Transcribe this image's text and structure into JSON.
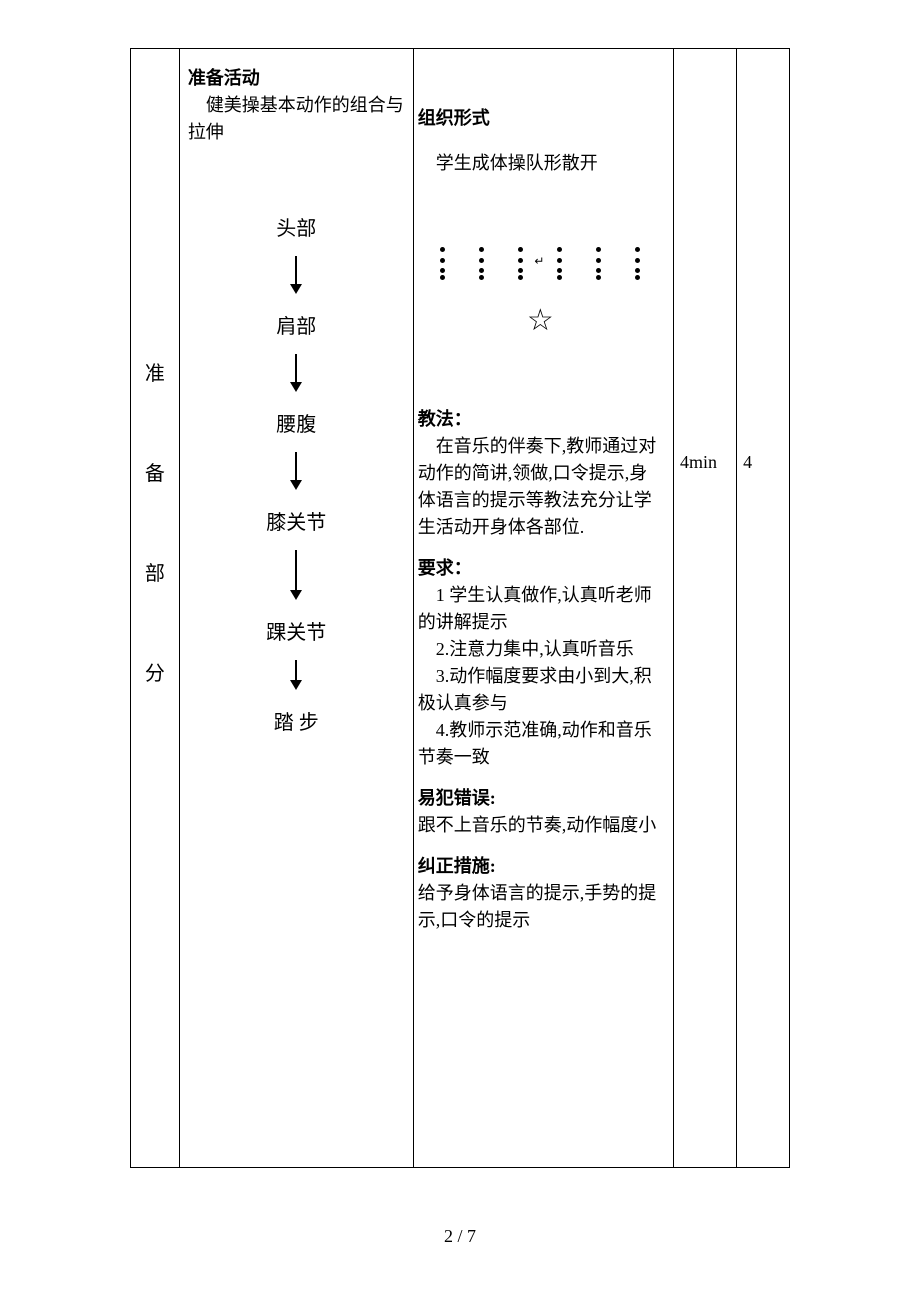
{
  "col1": {
    "c1": "准",
    "c2": "备",
    "c3": "部",
    "c4": "分"
  },
  "col2": {
    "title": "准备活动",
    "subtitle": "健美操基本动作的组合与拉伸",
    "steps": {
      "s1": "头部",
      "s2": "肩部",
      "s3": "腰腹",
      "s4": "膝关节",
      "s5": "踝关节",
      "s6": "踏 步"
    }
  },
  "col3": {
    "org_title": "组织形式",
    "org_text": "学生成体操队形散开",
    "method_title": "教法：",
    "method_text": "在音乐的伴奏下,教师通过对动作的简讲,领做,口令提示,身体语言的提示等教法充分让学生活动开身体各部位.",
    "req_title": "要求：",
    "req_1": "1 学生认真做作,认真听老师的讲解提示",
    "req_2": "2.注意力集中,认真听音乐",
    "req_3": "3.动作幅度要求由小到大,积极认真参与",
    "req_4": "4.教师示范准确,动作和音乐节奏一致",
    "err_title": "易犯错误:",
    "err_text": "跟不上音乐的节奏,动作幅度小",
    "fix_title": "纠正措施:",
    "fix_text": "给予身体语言的提示,手势的提示,口令的提示"
  },
  "col4": {
    "time": "4min"
  },
  "col5": {
    "count": "4"
  },
  "footer": "2 / 7"
}
